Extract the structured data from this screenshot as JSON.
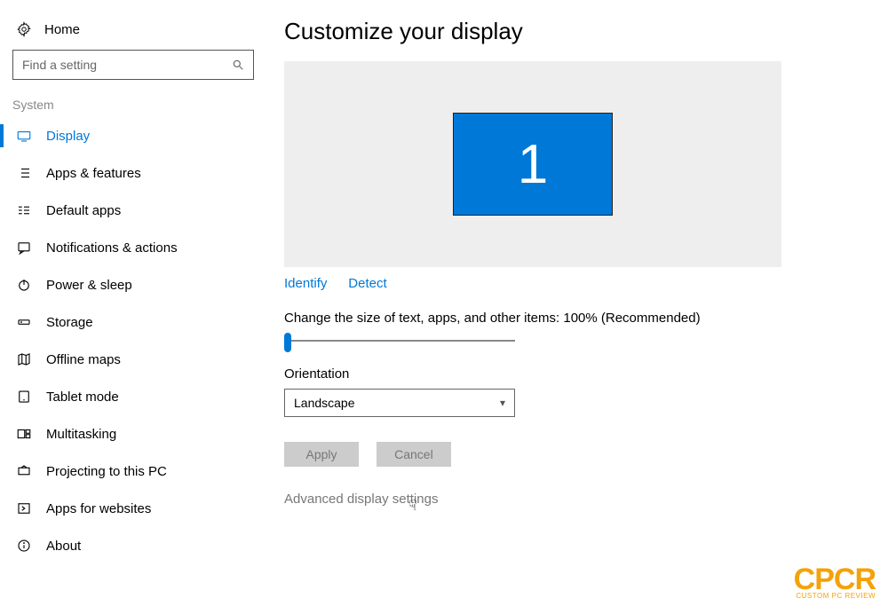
{
  "sidebar": {
    "home_label": "Home",
    "search_placeholder": "Find a setting",
    "section_label": "System",
    "items": [
      {
        "label": "Display",
        "active": true
      },
      {
        "label": "Apps & features"
      },
      {
        "label": "Default apps"
      },
      {
        "label": "Notifications & actions"
      },
      {
        "label": "Power & sleep"
      },
      {
        "label": "Storage"
      },
      {
        "label": "Offline maps"
      },
      {
        "label": "Tablet mode"
      },
      {
        "label": "Multitasking"
      },
      {
        "label": "Projecting to this PC"
      },
      {
        "label": "Apps for websites"
      },
      {
        "label": "About"
      }
    ]
  },
  "main": {
    "title": "Customize your display",
    "monitor_number": "1",
    "identify_label": "Identify",
    "detect_label": "Detect",
    "scale_label": "Change the size of text, apps, and other items: 100% (Recommended)",
    "orientation_label": "Orientation",
    "orientation_value": "Landscape",
    "apply_label": "Apply",
    "cancel_label": "Cancel",
    "advanced_label": "Advanced display settings"
  },
  "watermark": {
    "brand": "CPCR",
    "tagline": "CUSTOM PC REVIEW"
  }
}
